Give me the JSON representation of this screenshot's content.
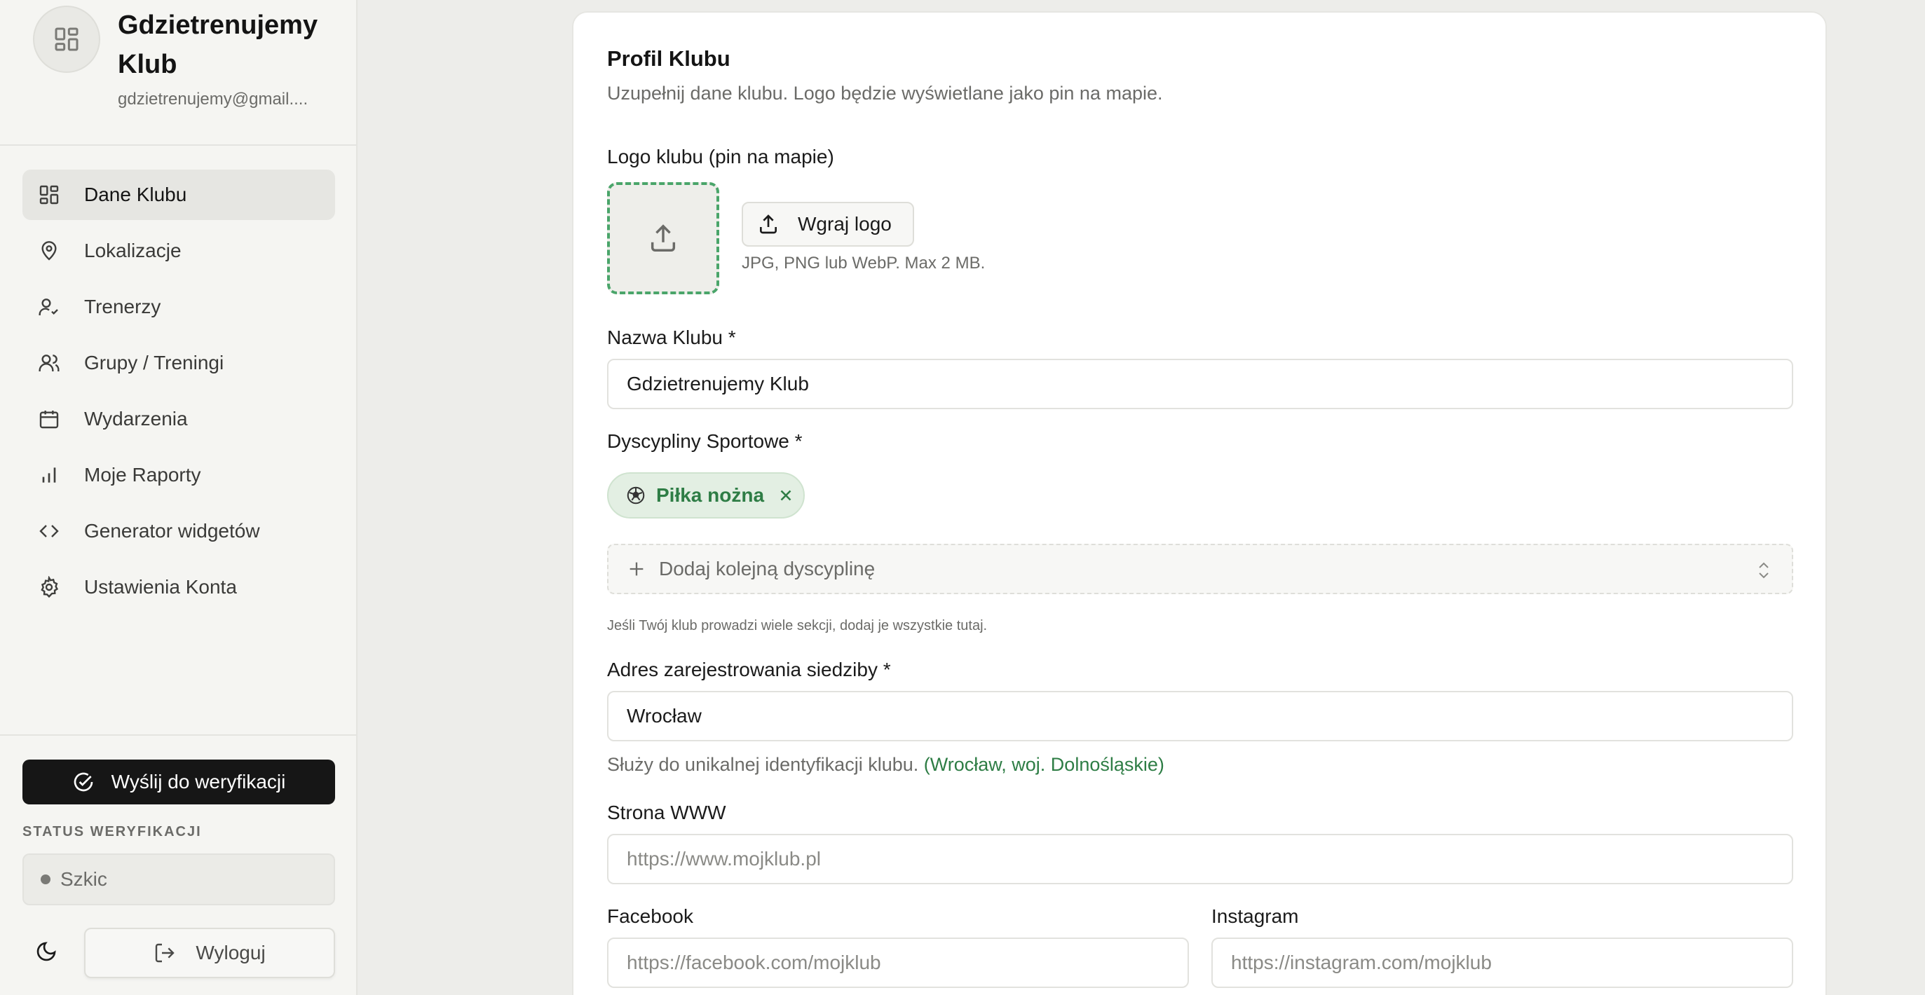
{
  "sidebar": {
    "club_name": "Gdzietrenujemy Klub",
    "club_email": "gdzietrenujemy@gmail....",
    "items": [
      {
        "label": "Dane Klubu",
        "icon": "dashboard-icon",
        "active": true
      },
      {
        "label": "Lokalizacje",
        "icon": "map-pin-icon"
      },
      {
        "label": "Trenerzy",
        "icon": "user-check-icon"
      },
      {
        "label": "Grupy / Treningi",
        "icon": "users-icon"
      },
      {
        "label": "Wydarzenia",
        "icon": "calendar-icon"
      },
      {
        "label": "Moje Raporty",
        "icon": "bar-chart-icon"
      },
      {
        "label": "Generator widgetów",
        "icon": "code-icon"
      },
      {
        "label": "Ustawienia Konta",
        "icon": "gear-icon"
      }
    ],
    "verify_button": "Wyślij do weryfikacji",
    "status_label": "STATUS WERYFIKACJI",
    "status_value": "Szkic",
    "logout": "Wyloguj"
  },
  "main": {
    "title": "Profil Klubu",
    "subtitle": "Uzupełnij dane klubu. Logo będzie wyświetlane jako pin na mapie.",
    "logo": {
      "label": "Logo klubu (pin na mapie)",
      "upload_button": "Wgraj logo",
      "hint": "JPG, PNG lub WebP. Max 2 MB."
    },
    "club_name": {
      "label": "Nazwa Klubu *",
      "value": "Gdzietrenujemy Klub"
    },
    "disciplines": {
      "label": "Dyscypliny Sportowe *",
      "chips": [
        "Piłka nożna"
      ],
      "add_placeholder": "Dodaj kolejną dyscyplinę",
      "hint": "Jeśli Twój klub prowadzi wiele sekcji, dodaj je wszystkie tutaj."
    },
    "address": {
      "label": "Adres zarejestrowania siedziby *",
      "value": "Wrocław",
      "hint": "Służy do unikalnej identyfikacji klubu.",
      "geo": "(Wrocław, woj. Dolnośląskie)"
    },
    "website": {
      "label": "Strona WWW",
      "placeholder": "https://www.mojklub.pl"
    },
    "facebook": {
      "label": "Facebook",
      "placeholder": "https://facebook.com/mojklub"
    },
    "instagram": {
      "label": "Instagram",
      "placeholder": "https://instagram.com/mojklub"
    }
  }
}
